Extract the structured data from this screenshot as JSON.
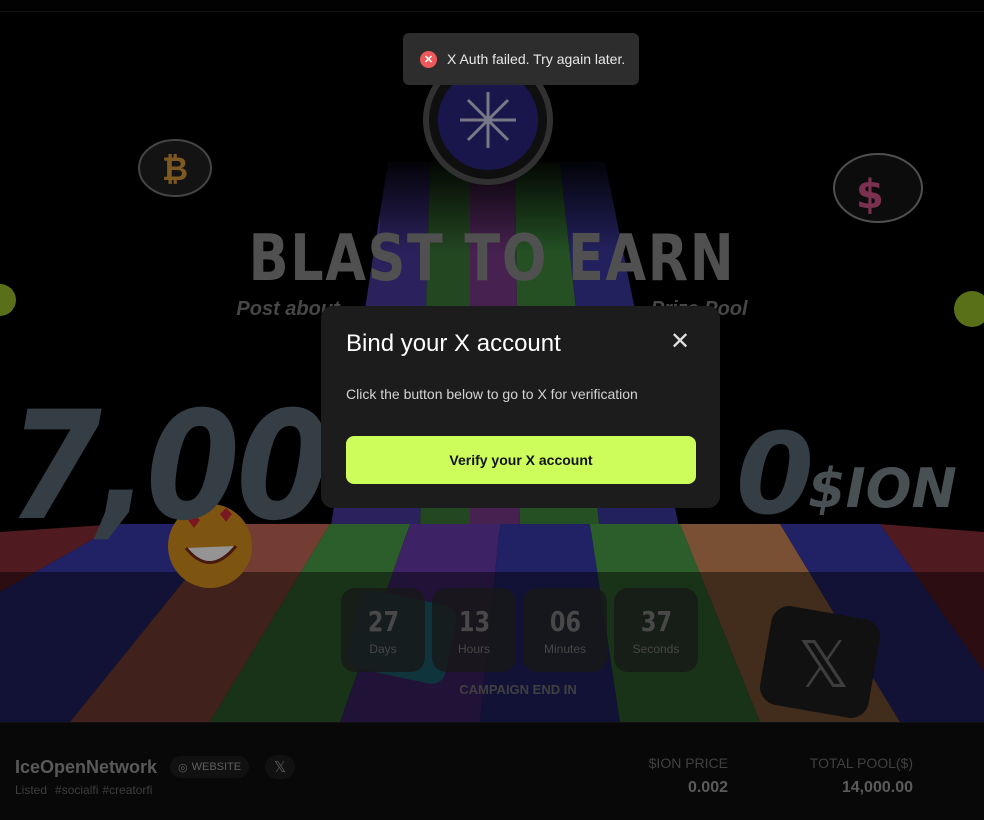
{
  "toast": {
    "icon": "error-circle-icon",
    "message": "X Auth failed. Try again later."
  },
  "hero": {
    "headline": "BLAST TO EARN",
    "subline_left": "Post about",
    "subline_right": "Prize Pool",
    "big_number_left": "7,00",
    "big_number_right": "0",
    "ticker": "$ION"
  },
  "countdown": {
    "items": [
      {
        "value": "27",
        "label": "Days"
      },
      {
        "value": "13",
        "label": "Hours"
      },
      {
        "value": "06",
        "label": "Minutes"
      },
      {
        "value": "37",
        "label": "Seconds"
      }
    ],
    "caption": "CAMPAIGN END IN"
  },
  "modal": {
    "title": "Bind your X account",
    "description": "Click the button below to go to X for verification",
    "button_label": "Verify your X account",
    "close_icon": "close-icon"
  },
  "footer": {
    "project_name": "IceOpenNetwork",
    "website_label": "WEBSITE",
    "x_label": "𝕏",
    "tags": [
      "Listed",
      "#socialfi",
      "#creatorfi"
    ],
    "price_label": "$ION PRICE",
    "price_value": "0.002",
    "pool_label": "TOTAL POOL($)",
    "pool_value": "14,000.00"
  },
  "colors": {
    "accent": "#cdfd5b",
    "error": "#ef5858",
    "modal_bg": "#1c1c1c"
  }
}
